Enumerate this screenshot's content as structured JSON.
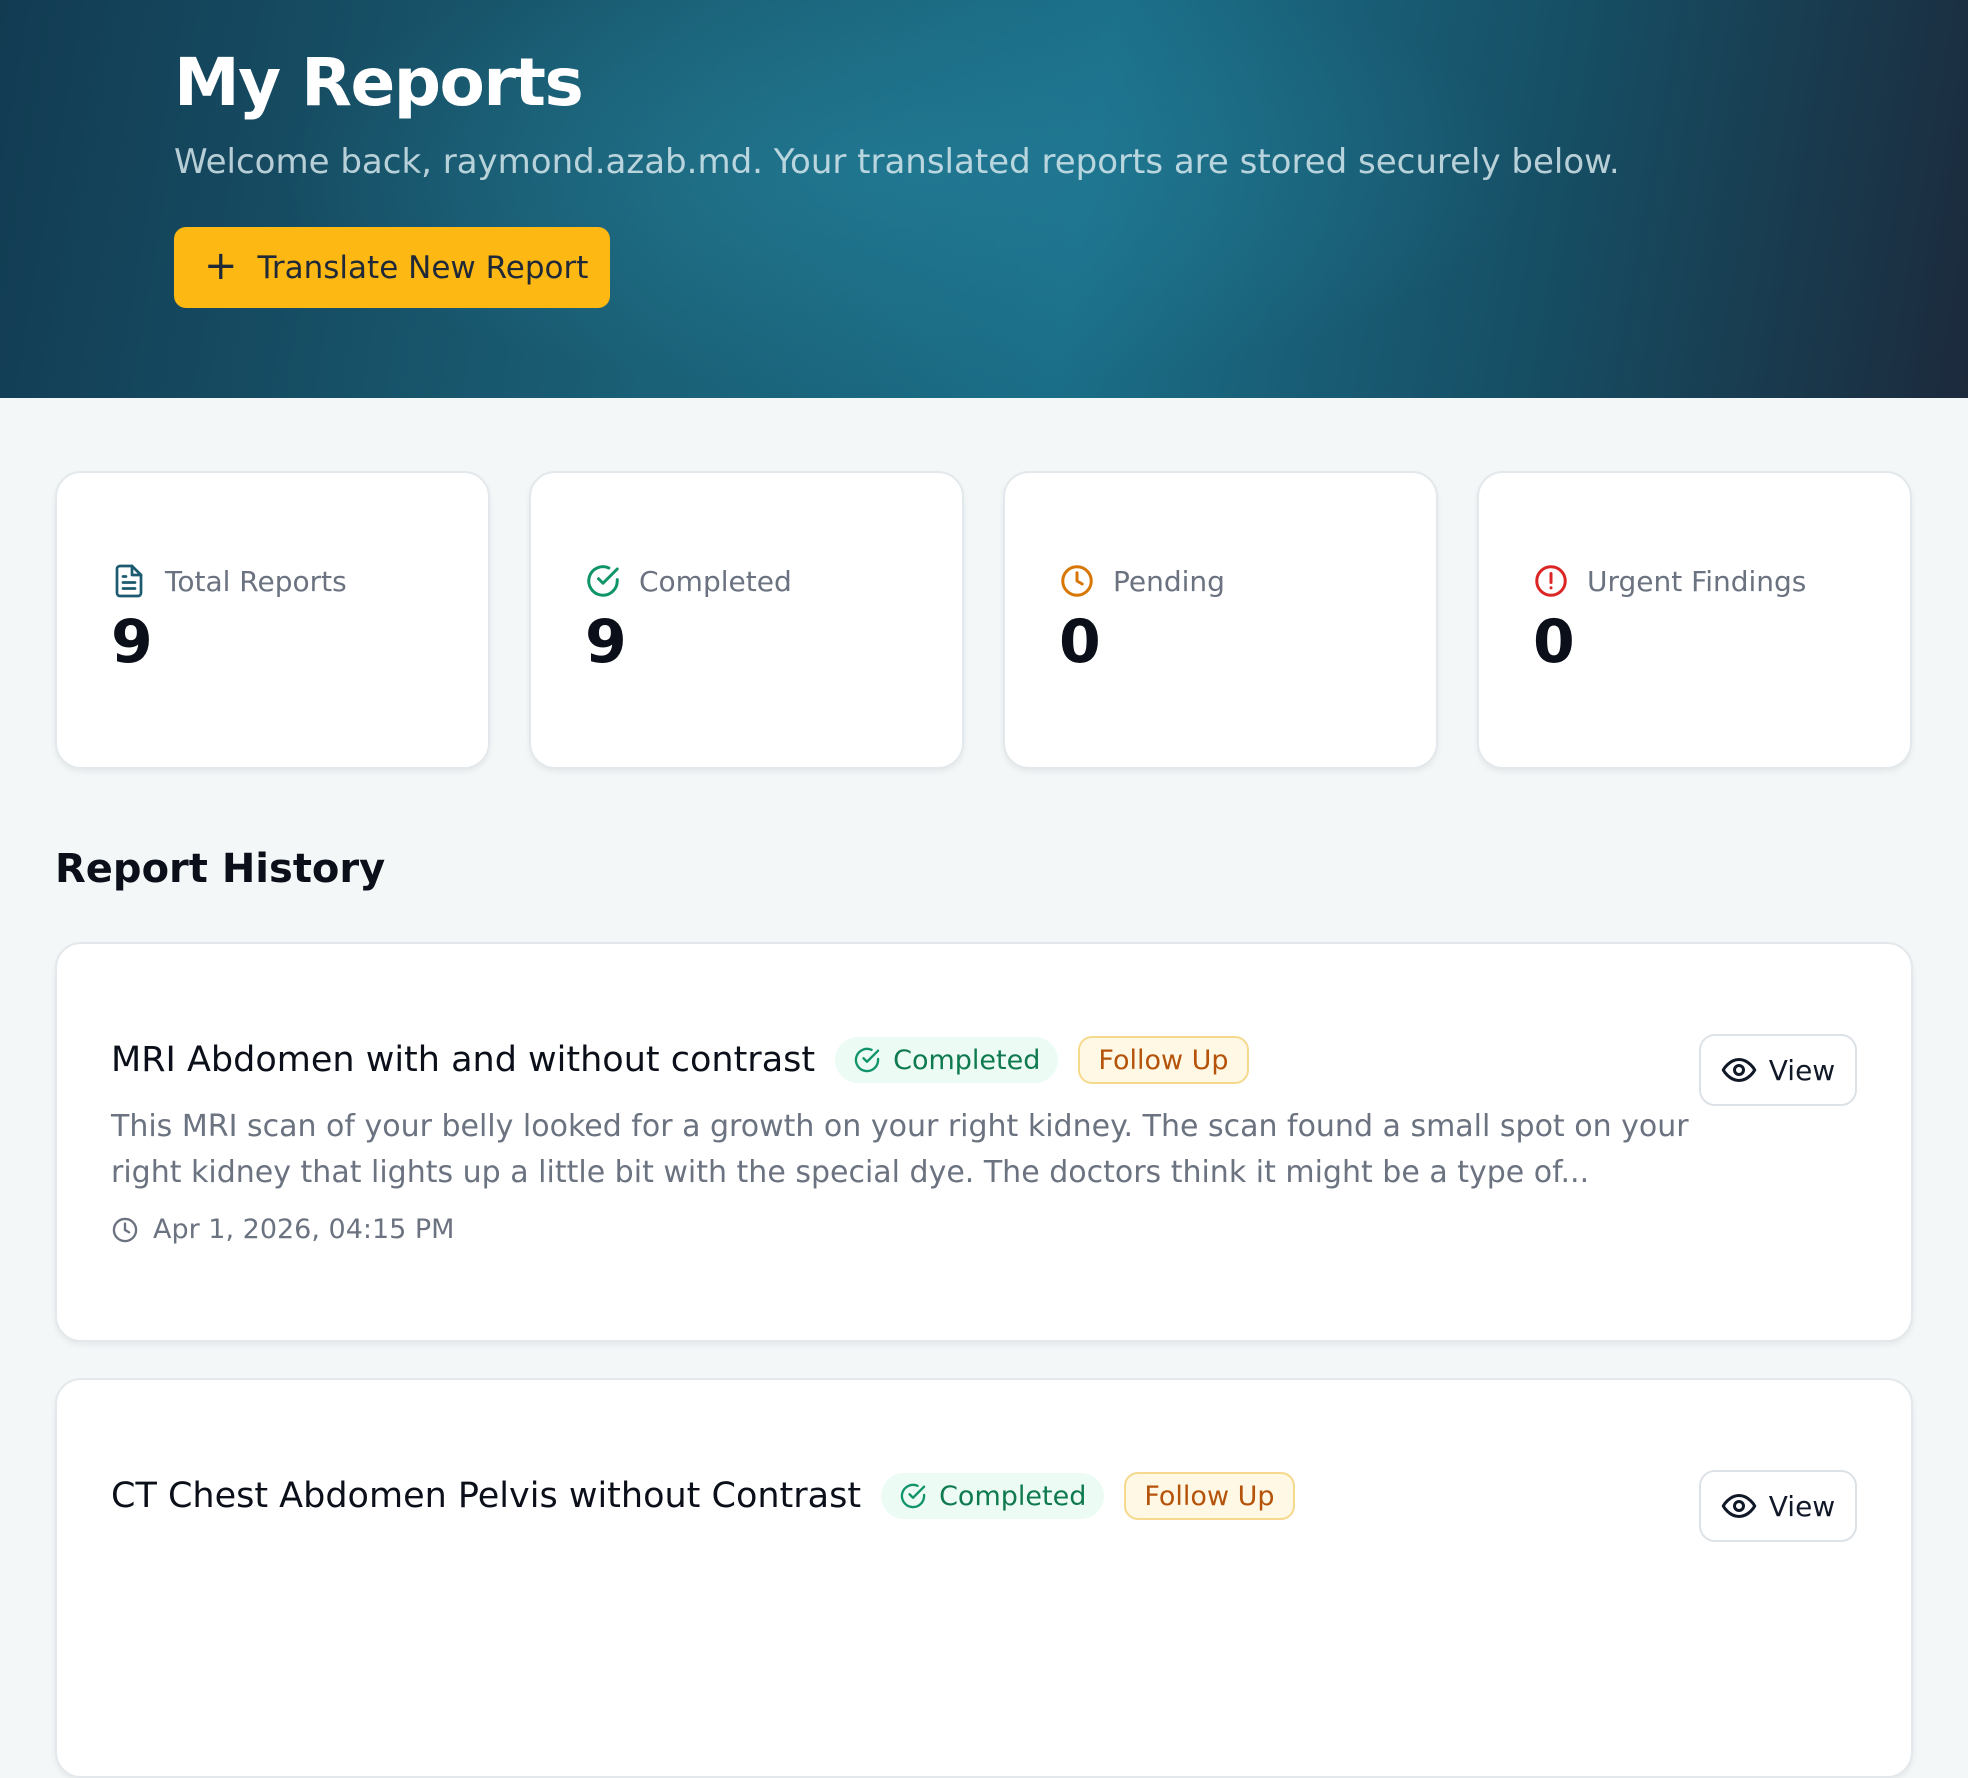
{
  "hero": {
    "title": "My Reports",
    "subtitle": "Welcome back, raymond.azab.md. Your translated reports are stored securely below.",
    "cta_label": "Translate New Report",
    "cta_icon": "plus-icon"
  },
  "stats": [
    {
      "label": "Total Reports",
      "value": "9",
      "icon": "document-icon",
      "color": "#1c5a70"
    },
    {
      "label": "Completed",
      "value": "9",
      "icon": "check-circle-icon",
      "color": "#10946a"
    },
    {
      "label": "Pending",
      "value": "0",
      "icon": "clock-icon",
      "color": "#d97706"
    },
    {
      "label": "Urgent Findings",
      "value": "0",
      "icon": "alert-circle-icon",
      "color": "#dc2626"
    }
  ],
  "history": {
    "title": "Report History",
    "reports": [
      {
        "title": "MRI Abdomen with and without contrast",
        "status": "Completed",
        "flag": "Follow Up",
        "summary": "This MRI scan of your belly looked for a growth on your right kidney. The scan found a small spot on your right kidney that lights up a little bit with the special dye. The doctors think it might be a type of...",
        "date": "Apr 1, 2026, 04:15 PM",
        "view_label": "View"
      },
      {
        "title": "CT Chest Abdomen Pelvis without Contrast",
        "status": "Completed",
        "flag": "Follow Up",
        "view_label": "View"
      }
    ]
  },
  "colors": {
    "accent": "#fdb813",
    "hero_bg": "#1a6076",
    "completed_text": "#0f7a4f",
    "follow_up_text": "#b45309"
  }
}
